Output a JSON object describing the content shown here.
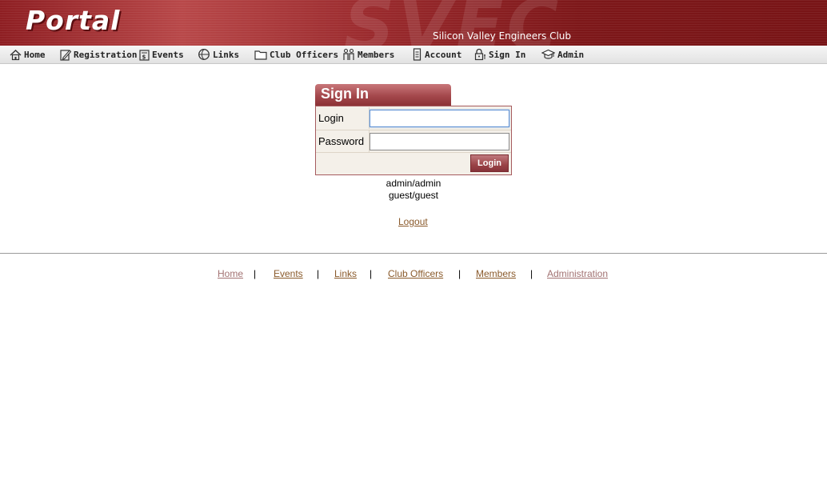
{
  "header": {
    "logo_text": "Portal",
    "watermark_text": "SVEC",
    "subtitle": "Silicon Valley Engineers Club",
    "brand_color": "#9a2a2d"
  },
  "menu": {
    "items": [
      {
        "label": "Home",
        "icon": "home-icon"
      },
      {
        "label": "Registration",
        "icon": "edit-icon"
      },
      {
        "label": "Events",
        "icon": "calendar-icon"
      },
      {
        "label": "Links",
        "icon": "globe-icon"
      },
      {
        "label": "Club Officers",
        "icon": "folder-icon"
      },
      {
        "label": "Members",
        "icon": "people-icon"
      },
      {
        "label": "Account",
        "icon": "document-icon"
      },
      {
        "label": "Sign In",
        "icon": "lock-icon"
      },
      {
        "label": "Admin",
        "icon": "graduation-cap-icon"
      }
    ]
  },
  "signin": {
    "title": "Sign In",
    "login_label": "Login",
    "login_value": "",
    "password_label": "Password",
    "password_value": "",
    "button_label": "Login"
  },
  "hints": {
    "line1": "admin/admin",
    "line2": "guest/guest"
  },
  "logout_label": "Logout",
  "footer": {
    "links": [
      "Home",
      "Events",
      "Links",
      "Club Officers",
      "Members",
      "Administration"
    ],
    "separator": "|"
  }
}
